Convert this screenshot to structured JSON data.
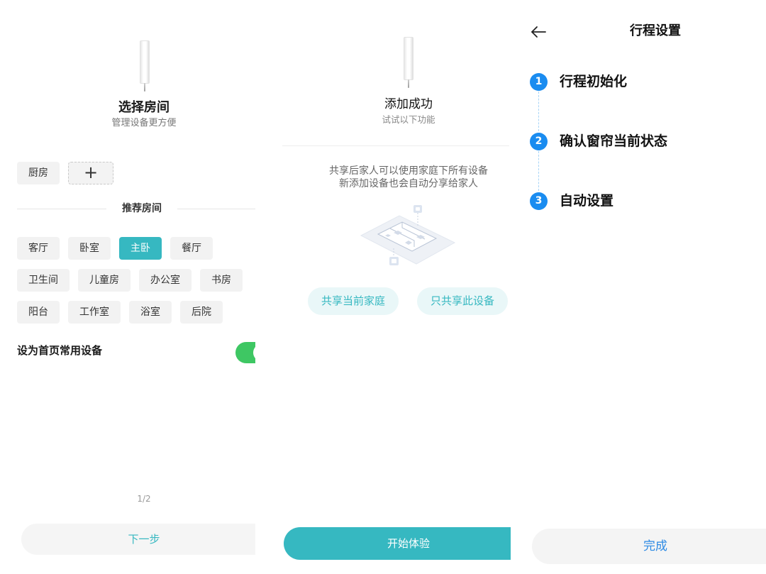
{
  "room_select": {
    "title": "选择房间",
    "subtitle": "管理设备更方便",
    "existing_rooms": [
      "厨房"
    ],
    "add_room_label": "+",
    "recommended_header": "推荐房间",
    "recommended_rooms": [
      "客厅",
      "卧室",
      "主卧",
      "餐厅",
      "卫生间",
      "儿童房",
      "办公室",
      "书房",
      "阳台",
      "工作室",
      "浴室",
      "后院"
    ],
    "selected_room": "主卧",
    "favorite_toggle": {
      "label": "设为首页常用设备",
      "on": true
    },
    "pager": "1/2",
    "next_button": "下一步"
  },
  "add_success": {
    "title": "添加成功",
    "subtitle": "试试以下功能",
    "share_description": [
      "共享后家人可以使用家庭下所有设备",
      "新添加设备也会自动分享给家人"
    ],
    "share_home_button": "共享当前家庭",
    "share_device_button": "只共享此设备",
    "start_button": "开始体验"
  },
  "travel_settings": {
    "title": "行程设置",
    "steps": [
      {
        "number": "1",
        "label": "行程初始化"
      },
      {
        "number": "2",
        "label": "确认窗帘当前状态"
      },
      {
        "number": "3",
        "label": "自动设置"
      }
    ],
    "done_button": "完成"
  },
  "icons": {
    "back": "arrow-left-icon",
    "add_room": "plus-icon",
    "device": "curtain-motor-image",
    "illustration": "home-floorplan-illustration"
  },
  "colors": {
    "accent_teal": "#36b8c1",
    "toggle_green": "#3ec763",
    "step_blue": "#1a8cf0",
    "done_text_blue": "#2d8ae4",
    "chip_background": "#f2f2f2"
  }
}
